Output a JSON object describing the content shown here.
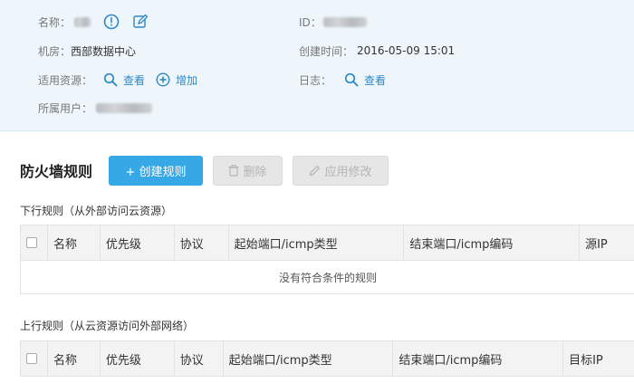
{
  "info": {
    "name_label": "名称：",
    "id_label": "ID：",
    "room_label": "机房：",
    "room_value": "西部数据中心",
    "created_label": "创建时间：",
    "created_value": "2016-05-09 15:01",
    "resources_label": "适用资源：",
    "view_label": "查看",
    "add_label": "增加",
    "log_label": "日志：",
    "log_view_label": "查看",
    "owner_label": "所属用户："
  },
  "toolbar": {
    "title": "防火墙规则",
    "create_label": "+ 创建规则",
    "delete_label": "删除",
    "apply_label": "应用修改"
  },
  "inbound": {
    "title": "下行规则（从外部访问云资源）",
    "columns": [
      "名称",
      "优先级",
      "协议",
      "起始端口/icmp类型",
      "结束端口/icmp编码",
      "源IP"
    ],
    "empty_text": "没有符合条件的规则"
  },
  "outbound": {
    "title": "上行规则（从云资源访问外部网络）",
    "columns": [
      "名称",
      "优先级",
      "协议",
      "起始端口/icmp类型",
      "结束端口/icmp编码",
      "目标IP"
    ]
  },
  "colors": {
    "accent": "#37a8e6",
    "link": "#2e88c7",
    "panel_bg": "#eef6fc"
  }
}
